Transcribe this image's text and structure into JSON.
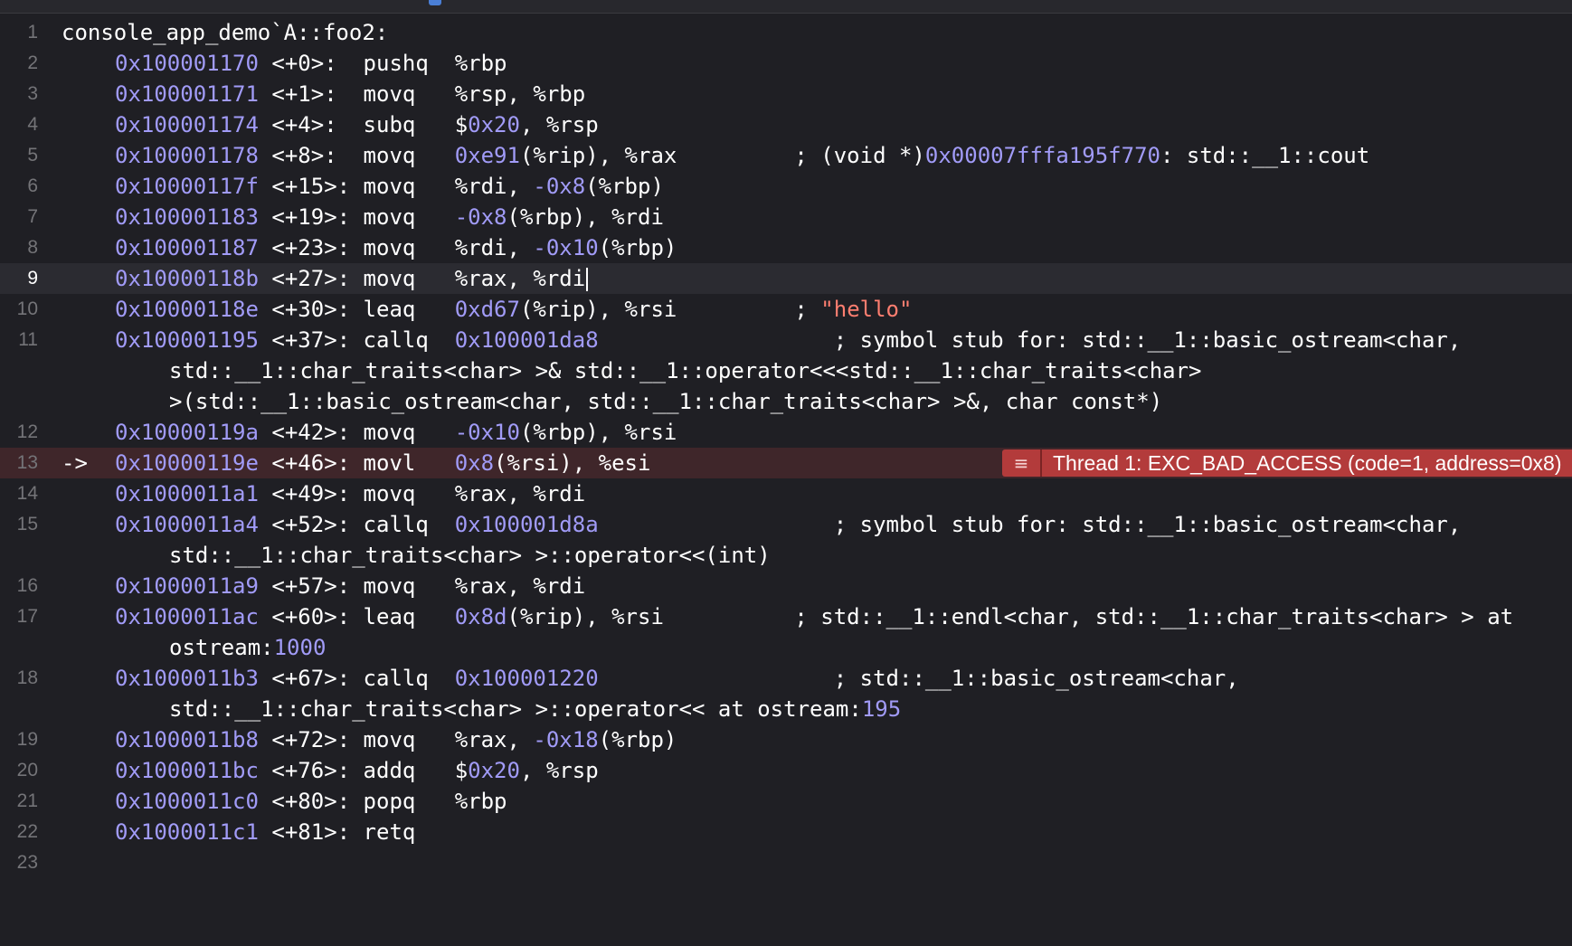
{
  "header": {
    "function_label": "console_app_demo`A::foo2:"
  },
  "pc_marker": "->",
  "error": {
    "icon": "≡",
    "message": "Thread 1: EXC_BAD_ACCESS (code=1, address=0x8)"
  },
  "lines": [
    {
      "n": "1"
    },
    {
      "n": "2",
      "addr": "0x100001170",
      "off": " <+0>:  ",
      "op": "pushq  ",
      "a1": "%rbp"
    },
    {
      "n": "3",
      "addr": "0x100001171",
      "off": " <+1>:  ",
      "op": "movq   ",
      "a1": "%rsp, %rbp"
    },
    {
      "n": "4",
      "addr": "0x100001174",
      "off": " <+4>:  ",
      "op": "subq   ",
      "a1": "$",
      "a2": "0x20",
      "a3": ", %rsp"
    },
    {
      "n": "5",
      "addr": "0x100001178",
      "off": " <+8>:  ",
      "op": "movq   ",
      "a1": "0xe91",
      "a2": "(%rip), %rax",
      "cm1": "         ; (void *)",
      "cm2": "0x00007fffa195f770",
      "cm3": ": std::__1::cout"
    },
    {
      "n": "6",
      "addr": "0x10000117f",
      "off": " <+15>: ",
      "op": "movq   ",
      "a1": "%rdi, ",
      "a2": "-0x8",
      "a3": "(%rbp)"
    },
    {
      "n": "7",
      "addr": "0x100001183",
      "off": " <+19>: ",
      "op": "movq   ",
      "a1": "-0x8",
      "a2": "(%rbp), %rdi"
    },
    {
      "n": "8",
      "addr": "0x100001187",
      "off": " <+23>: ",
      "op": "movq   ",
      "a1": "%rdi, ",
      "a2": "-0x10",
      "a3": "(%rbp)"
    },
    {
      "n": "9",
      "addr": "0x10000118b",
      "off": " <+27>: ",
      "op": "movq   ",
      "a1": "%rax, %rdi"
    },
    {
      "n": "10",
      "addr": "0x10000118e",
      "off": " <+30>: ",
      "op": "leaq   ",
      "a1": "0xd67",
      "a2": "(%rip), %rsi",
      "cm1": "         ; ",
      "cm2": "\"hello\""
    },
    {
      "n": "11",
      "addr": "0x100001195",
      "off": " <+37>: ",
      "op": "callq  ",
      "a1": "0x100001da8",
      "cm1": "                  ; symbol stub for: std::__1::basic_ostream<char,",
      "cont": [
        "std::__1::char_traits<char> >& std::__1::operator<<<std::__1::char_traits<char>",
        ">(std::__1::basic_ostream<char, std::__1::char_traits<char> >&, char const*)"
      ]
    },
    {
      "n": "12",
      "addr": "0x10000119a",
      "off": " <+42>: ",
      "op": "movq   ",
      "a1": "-0x10",
      "a2": "(%rbp), %rsi"
    },
    {
      "n": "13",
      "addr": "0x10000119e",
      "off": " <+46>: ",
      "op": "movl   ",
      "a1": "0x8",
      "a2": "(%rsi), %esi"
    },
    {
      "n": "14",
      "addr": "0x1000011a1",
      "off": " <+49>: ",
      "op": "movq   ",
      "a1": "%rax, %rdi"
    },
    {
      "n": "15",
      "addr": "0x1000011a4",
      "off": " <+52>: ",
      "op": "callq  ",
      "a1": "0x100001d8a",
      "cm1": "                  ; symbol stub for: std::__1::basic_ostream<char,",
      "cont": [
        "std::__1::char_traits<char> >::operator<<(int)"
      ]
    },
    {
      "n": "16",
      "addr": "0x1000011a9",
      "off": " <+57>: ",
      "op": "movq   ",
      "a1": "%rax, %rdi"
    },
    {
      "n": "17",
      "addr": "0x1000011ac",
      "off": " <+60>: ",
      "op": "leaq   ",
      "a1": "0x8d",
      "a2": "(%rip), %rsi",
      "cm1": "          ; std::__1::endl<char, std::__1::char_traits<char> > at",
      "cont1a": "ostream:",
      "cont1b": "1000"
    },
    {
      "n": "18",
      "addr": "0x1000011b3",
      "off": " <+67>: ",
      "op": "callq  ",
      "a1": "0x100001220",
      "cm1": "                  ; std::__1::basic_ostream<char,",
      "cont1a": "std::__1::char_traits<char> >::operator<< at ostream:",
      "cont1b": "195"
    },
    {
      "n": "19",
      "addr": "0x1000011b8",
      "off": " <+72>: ",
      "op": "movq   ",
      "a1": "%rax, ",
      "a2": "-0x18",
      "a3": "(%rbp)"
    },
    {
      "n": "20",
      "addr": "0x1000011bc",
      "off": " <+76>: ",
      "op": "addq   ",
      "a1": "$",
      "a2": "0x20",
      "a3": ", %rsp"
    },
    {
      "n": "21",
      "addr": "0x1000011c0",
      "off": " <+80>: ",
      "op": "popq   ",
      "a1": "%rbp"
    },
    {
      "n": "22",
      "addr": "0x1000011c1",
      "off": " <+81>: ",
      "op": "retq"
    },
    {
      "n": "23"
    }
  ]
}
